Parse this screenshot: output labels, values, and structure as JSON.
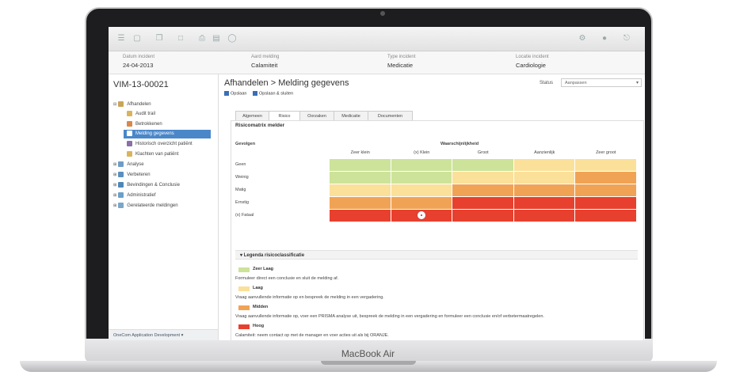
{
  "device": {
    "brand": "MacBook Air"
  },
  "toolbar": {
    "icons": [
      "menu-icon",
      "document-icon",
      "copy-icon",
      "page-icon",
      "print-icon",
      "export-icon",
      "filter-icon",
      "settings-icon",
      "user-icon",
      "power-icon"
    ]
  },
  "infobar": [
    {
      "label": "Datum incident",
      "value": "24-04-2013"
    },
    {
      "label": "Aard melding",
      "value": "Calamiteit"
    },
    {
      "label": "Type incident",
      "value": "Medicatie"
    },
    {
      "label": "Locatie incident",
      "value": "Cardiologie"
    }
  ],
  "sidebar": {
    "case_id": "VIM-13-00021",
    "items": [
      {
        "label": "Afhandelen",
        "icon": "tool-icon",
        "color": "#c9a55b"
      },
      {
        "label": "Audit trail",
        "icon": "tool-icon",
        "color": "#d9b45c"
      },
      {
        "label": "Betrokkenen",
        "icon": "people-icon",
        "color": "#d9874a"
      },
      {
        "label": "Melding gegevens",
        "icon": "form-icon",
        "color": "#ffffff"
      },
      {
        "label": "Historisch overzicht patiënt",
        "icon": "person-icon",
        "color": "#8a6fa8"
      },
      {
        "label": "Klachten van patiënt",
        "icon": "tool-icon",
        "color": "#d9b45c"
      },
      {
        "label": "Analyse",
        "icon": "chart-icon",
        "color": "#6f9cc7"
      },
      {
        "label": "Verbeteren",
        "icon": "people-icon",
        "color": "#5b8fbf"
      },
      {
        "label": "Bevindingen & Conclusie",
        "icon": "gear-icon",
        "color": "#4f86b8"
      },
      {
        "label": "Administratief",
        "icon": "document-icon",
        "color": "#6aa0c9"
      },
      {
        "label": "Gerelateerde meldingen",
        "icon": "link-icon",
        "color": "#7aa7c8"
      }
    ],
    "footer": "OneCom Application Development ▾"
  },
  "main": {
    "title": "Afhandelen > Melding gegevens",
    "status_label": "Status",
    "status_value": "Aanpassen",
    "actions": [
      "Opslaan",
      "Opslaan & sluiten"
    ],
    "tabs": [
      "Algemeen",
      "Risico",
      "Oorzaken",
      "Medicatie",
      "Documenten"
    ],
    "active_tab": "Risico"
  },
  "matrix": {
    "title": "Risicomatrix melder",
    "y_header": "Gevolgen",
    "x_header": "Waarschijnlijkheid",
    "columns": [
      "Zeer klein",
      "(x) Klein",
      "Groot",
      "Aanzienlijk",
      "Zeer groot"
    ],
    "rows": [
      "Geen",
      "Weinig",
      "Matig",
      "Ernstig",
      "(x) Fataal"
    ],
    "colors": {
      "G": "#cde39a",
      "Y": "#fbe09a",
      "O": "#f1a355",
      "R": "#e8402e"
    },
    "grid": [
      [
        "G",
        "G",
        "G",
        "Y",
        "Y"
      ],
      [
        "G",
        "G",
        "Y",
        "Y",
        "O"
      ],
      [
        "Y",
        "Y",
        "O",
        "O",
        "O"
      ],
      [
        "O",
        "O",
        "R",
        "R",
        "R"
      ],
      [
        "R",
        "R",
        "R",
        "R",
        "R"
      ]
    ],
    "selected": {
      "row": "(x) Fataal",
      "column": "(x) Klein"
    }
  },
  "legend": {
    "title": "Legenda risicoclassificatie",
    "items": [
      {
        "name": "Zeer Laag",
        "color": "#cde39a",
        "desc": "Formuleer direct een conclusie en sluit de melding af."
      },
      {
        "name": "Laag",
        "color": "#fbe09a",
        "desc": "Vraag aanvullende informatie op en bespreek de melding in een vergadering."
      },
      {
        "name": "Midden",
        "color": "#f1a355",
        "desc": "Vraag aanvullende informatie op, voer een PRISMA analyse uit, bespreek de melding in een vergadering en formuleer een conclusie en/of verbetermaatregelen."
      },
      {
        "name": "Hoog",
        "color": "#e8402e",
        "desc": "Calamiteit: neem contact op met de manager en voer acties uit als bij ORANJE."
      }
    ]
  }
}
